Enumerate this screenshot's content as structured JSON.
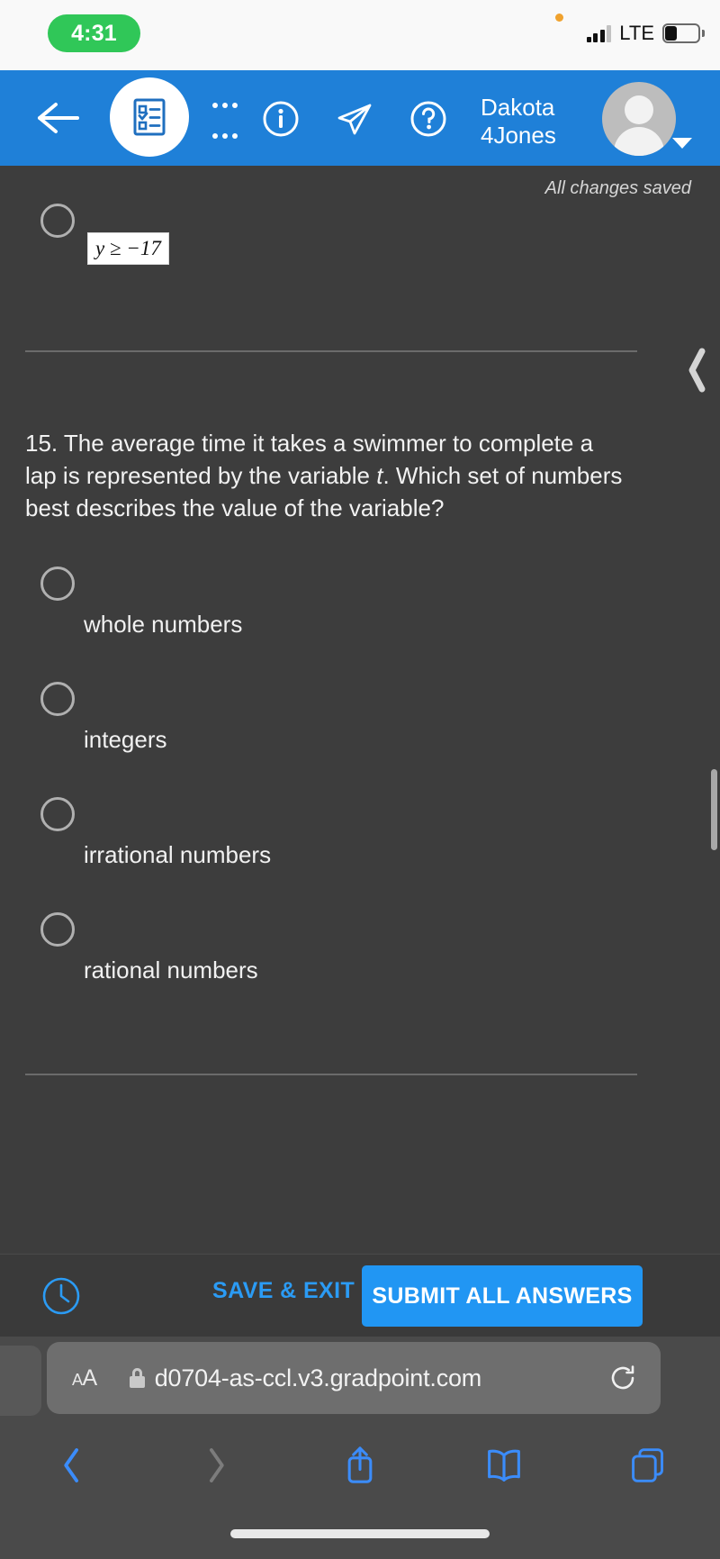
{
  "status_bar": {
    "time": "4:31",
    "carrier_tech": "LTE",
    "signal_bars_filled": 3,
    "signal_bars_total": 4,
    "battery_percent": 30,
    "privacy_indicator": "orange-dot",
    "time_pill_color": "#30c758"
  },
  "app_header": {
    "background_color": "#1f80d8",
    "back_label": "back-arrow",
    "logo_icon": "checklist-clipboard-icon",
    "more_menu_icon": "ellipsis-icon",
    "info_icon": "info-circle-icon",
    "send_icon": "paper-plane-icon",
    "help_icon": "question-circle-icon",
    "user_name_line1": "Dakota",
    "user_name_line2": "4Jones",
    "avatar_icon": "person-avatar",
    "dropdown_icon": "caret-down-icon"
  },
  "quiz": {
    "save_status": "All changes saved",
    "previous_question_tail": {
      "option_label": "y ≥ −17",
      "option_selected": false
    },
    "collapse_icon": "chevron-left-icon",
    "current_question": {
      "number": "15.",
      "text": "The average time it takes a swimmer to complete a lap is represented by the variable ",
      "variable": "t",
      "text_after": ". Which set of numbers best describes the value of the variable?",
      "options": [
        {
          "label": "whole numbers",
          "selected": false
        },
        {
          "label": "integers",
          "selected": false
        },
        {
          "label": "irrational numbers",
          "selected": false
        },
        {
          "label": "rational numbers",
          "selected": false
        }
      ]
    }
  },
  "action_bar": {
    "timer_icon": "clock-icon",
    "save_exit_label": "SAVE & EXIT",
    "submit_label": "SUBMIT ALL ANSWERS",
    "submit_color": "#2196f3",
    "link_color": "#2b9bf4"
  },
  "browser": {
    "text_size_label": "AA",
    "secure_icon": "lock-icon",
    "url": "d0704-as-ccl.v3.gradpoint.com",
    "reload_icon": "reload-icon",
    "back_icon": "chevron-left-icon",
    "forward_icon": "chevron-right-icon",
    "share_icon": "share-icon",
    "bookmarks_icon": "book-icon",
    "tabs_icon": "tabs-icon",
    "back_enabled": true,
    "forward_enabled": false,
    "accent_color": "#3b8cfa"
  }
}
